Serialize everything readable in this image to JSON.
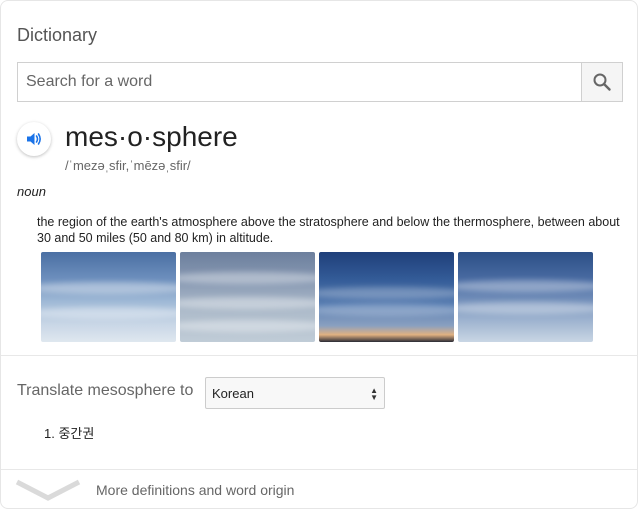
{
  "dictionary": {
    "title": "Dictionary",
    "search": {
      "placeholder": "Search for a word",
      "value": ""
    },
    "entry": {
      "word": "mes·o·sphere",
      "pronunciation": "/ˈmezəˌsfir,ˈmēzəˌsfir/",
      "part_of_speech": "noun",
      "definition": "the region of the earth's atmosphere above the stratosphere and below the thermosphere, between about 30 and 50 miles (50 and 80 km) in altitude."
    },
    "translate": {
      "label": "Translate mesosphere to",
      "selected_language": "Korean",
      "results": [
        "1. 중간권"
      ]
    },
    "more_link": "More definitions and word origin"
  },
  "colors": {
    "accent": "#1a73e8",
    "muted_text": "#666666",
    "divider": "#e8e8e8"
  },
  "icons": [
    "search-icon",
    "speaker-icon",
    "chevron-down-icon"
  ]
}
